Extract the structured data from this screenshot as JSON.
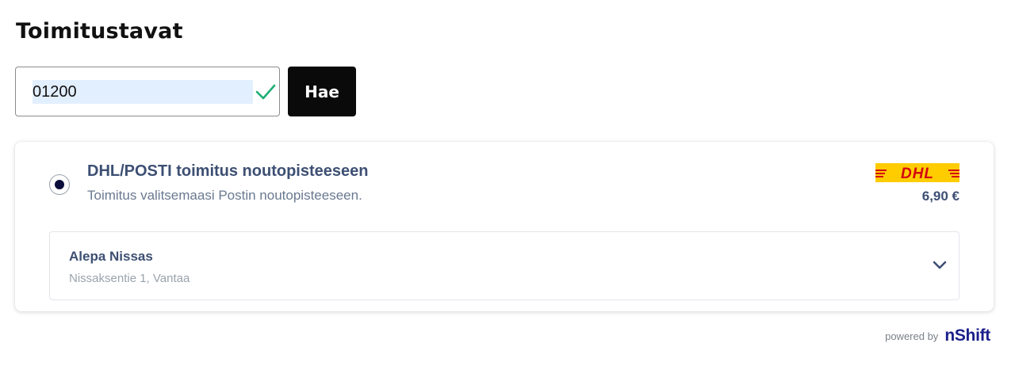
{
  "header": {
    "title": "Toimitustavat"
  },
  "postal_code": {
    "value": "01200",
    "validated": true
  },
  "search_button": {
    "label": "Hae"
  },
  "shipping_option": {
    "selected": true,
    "name": "DHL/POSTI toimitus noutopisteeseen",
    "description": "Toimitus valitsemaasi Postin noutopisteeseen.",
    "carrier_logo": "DHL",
    "price": "6,90 €",
    "pickup_point": {
      "name": "Alepa Nissas",
      "address": "Nissaksentie 1, Vantaa"
    }
  },
  "footer": {
    "powered_by": "powered by",
    "brand": "nShift"
  },
  "colors": {
    "accent_dark": "#0b0d3a",
    "text_primary": "#3d4f73",
    "check_green": "#1fae74",
    "dhl_yellow": "#ffcc00",
    "dhl_red": "#d40511",
    "nshift_blue": "#1b1f8a"
  }
}
